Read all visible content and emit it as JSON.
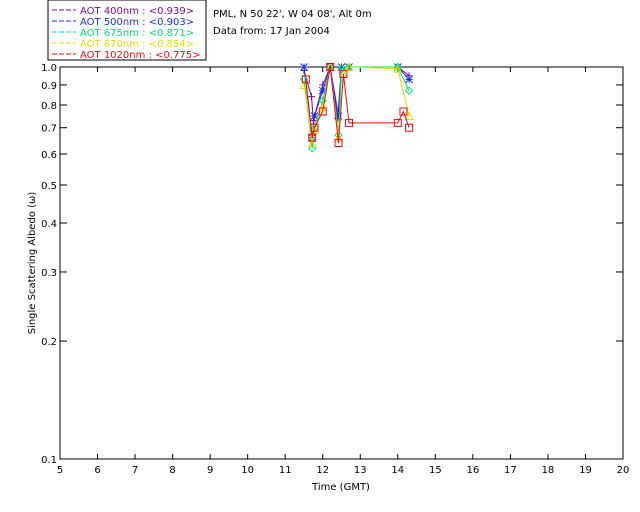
{
  "header": {
    "site": "PML, N 50 22', W 04 08', Alt 0m",
    "date_line": "Data from: 17 Jan 2004"
  },
  "chart_data": {
    "type": "line",
    "xlabel": "Time (GMT)",
    "ylabel": "Single Scattering Albedo (ω)",
    "xlim": [
      5,
      20
    ],
    "ylim": [
      0.1,
      1.0
    ],
    "yscale": "log",
    "grid": false,
    "legend_placement": "top-left",
    "x_ticks": [
      "5",
      "6",
      "7",
      "8",
      "9",
      "10",
      "11",
      "12",
      "13",
      "14",
      "15",
      "16",
      "17",
      "18",
      "19",
      "20"
    ],
    "y_ticks": [
      {
        "value": 0.1,
        "label": "0.1"
      },
      {
        "value": 0.2,
        "label": "0.2"
      },
      {
        "value": 0.3,
        "label": "0.3"
      },
      {
        "value": 0.4,
        "label": "0.4"
      },
      {
        "value": 0.5,
        "label": "0.5"
      },
      {
        "value": 0.6,
        "label": "0.6"
      },
      {
        "value": 0.7,
        "label": "0.7"
      },
      {
        "value": 0.8,
        "label": "0.8"
      },
      {
        "value": 0.9,
        "label": "0.9"
      },
      {
        "value": 1.0,
        "label": "1.0"
      }
    ],
    "series": [
      {
        "name": "AOT  400nm : <0.939>",
        "color": "#7b0f8f",
        "marker": "plus",
        "x": [
          11.5,
          11.7,
          11.75,
          12.0,
          12.2,
          12.4,
          12.5,
          12.7,
          14.0,
          14.3
        ],
        "y": [
          0.98,
          0.84,
          0.73,
          0.9,
          1.0,
          0.74,
          1.0,
          1.0,
          1.0,
          0.95
        ]
      },
      {
        "name": "AOT  500nm : <0.903>",
        "color": "#1a2fe0",
        "marker": "asterisk",
        "x": [
          11.5,
          11.72,
          11.78,
          12.0,
          12.2,
          12.42,
          12.5,
          12.7,
          14.0,
          14.3
        ],
        "y": [
          1.0,
          0.66,
          0.75,
          0.87,
          1.0,
          0.75,
          1.0,
          1.0,
          1.0,
          0.93
        ]
      },
      {
        "name": "AOT  675nm : <0.871>",
        "color": "#00e070",
        "marker": "diamond",
        "x": [
          11.5,
          11.72,
          11.78,
          12.0,
          12.2,
          12.42,
          12.5,
          12.7,
          14.0,
          14.3
        ],
        "y": [
          0.93,
          0.62,
          0.7,
          0.82,
          1.0,
          0.67,
          0.99,
          1.0,
          1.0,
          0.87
        ]
      },
      {
        "name": "AOT  870nm : <0.854>",
        "color": "#e8d800",
        "marker": "triangle",
        "x": [
          11.5,
          11.72,
          11.78,
          12.0,
          12.2,
          12.42,
          12.55,
          12.7,
          14.0,
          14.3
        ],
        "y": [
          0.9,
          0.64,
          0.69,
          0.79,
          1.0,
          0.66,
          0.96,
          1.0,
          0.99,
          0.75
        ]
      },
      {
        "name": "AOT 1020nm : <0.775>",
        "color": "#e01010",
        "marker": "square",
        "x": [
          11.55,
          11.72,
          11.78,
          12.0,
          12.2,
          12.42,
          12.55,
          12.7,
          14.0,
          14.15,
          14.3
        ],
        "y": [
          0.93,
          0.66,
          0.7,
          0.77,
          1.0,
          0.64,
          0.96,
          0.72,
          0.72,
          0.77,
          0.7
        ]
      }
    ]
  }
}
